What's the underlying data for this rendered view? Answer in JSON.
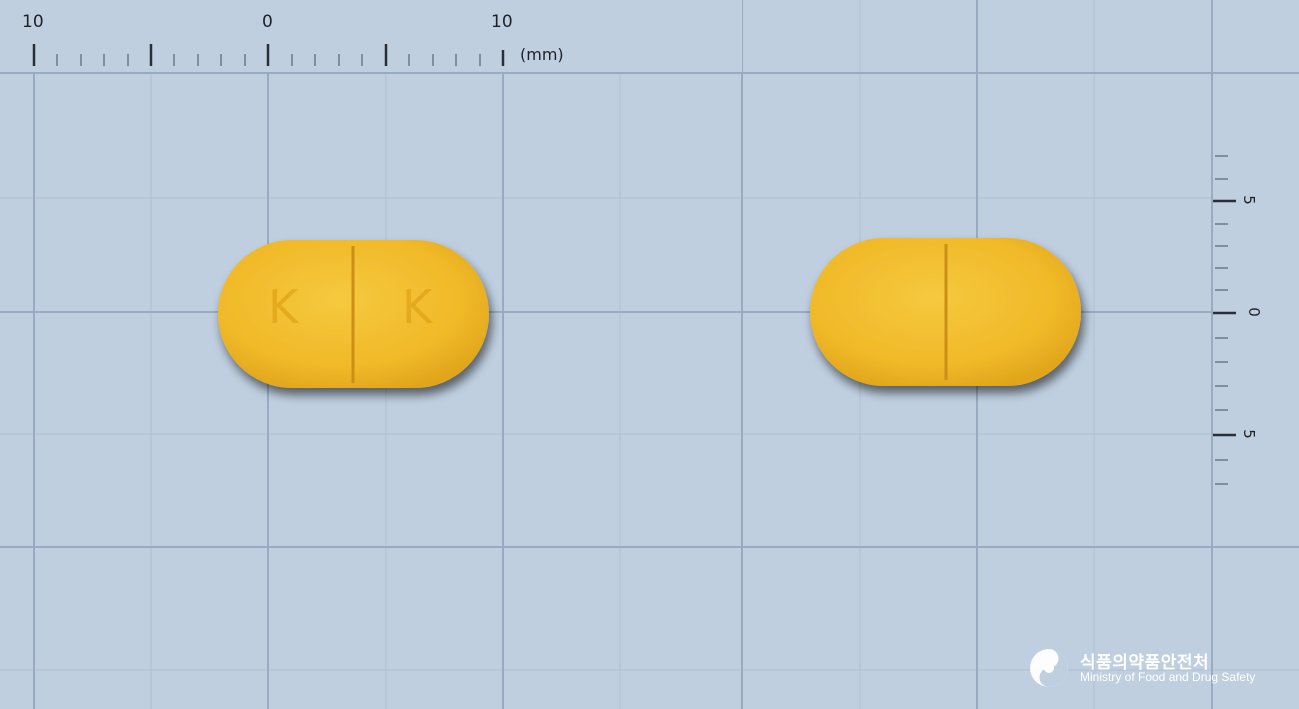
{
  "ruler_top": {
    "labels": [
      "10",
      "0",
      "10"
    ],
    "unit": "(mm)"
  },
  "ruler_side": {
    "labels": [
      "5",
      "0",
      "5"
    ]
  },
  "pill_front": {
    "imprint_left": "K",
    "imprint_right": "K",
    "color": "#f1bc2c"
  },
  "pill_back": {
    "color": "#f1bc2c"
  },
  "logo": {
    "icon": "taegeuk-emblem-icon",
    "korean": "식품의약품안전처",
    "english": "Ministry of Food and Drug Safety"
  }
}
